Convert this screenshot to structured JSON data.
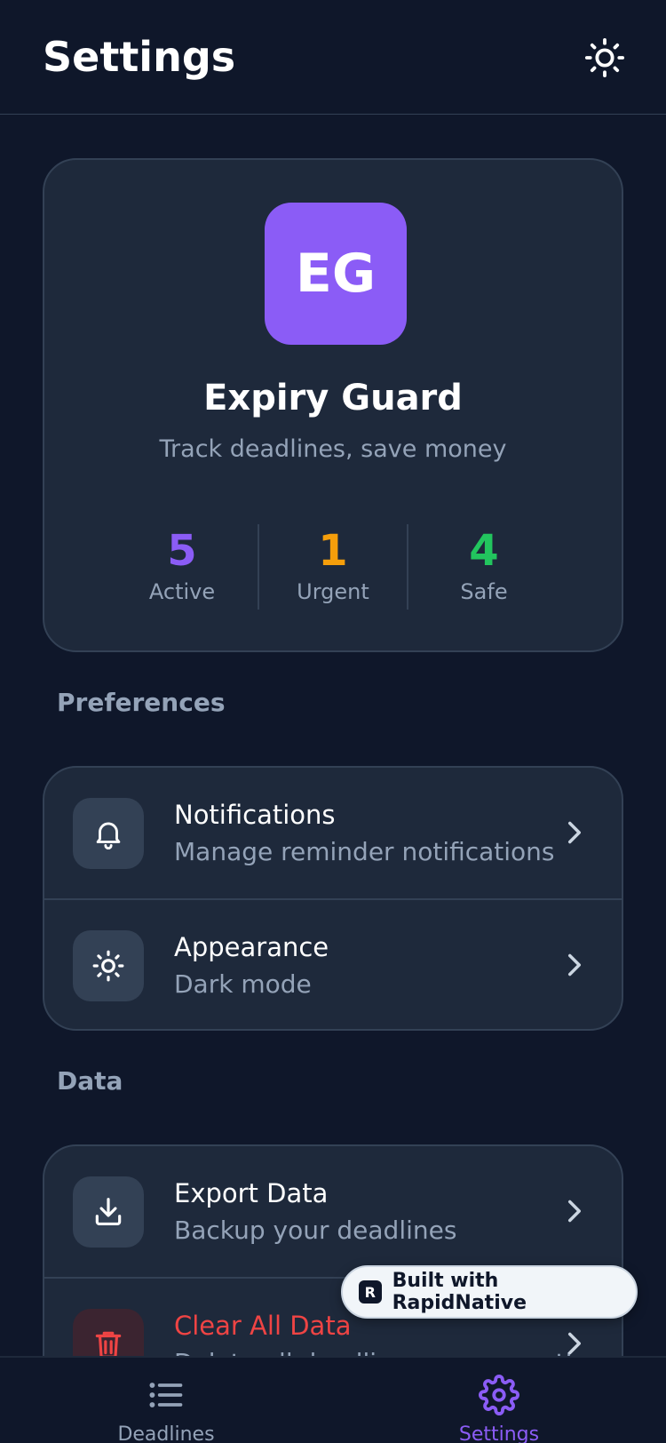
{
  "header": {
    "title": "Settings",
    "theme_icon": "sun-icon"
  },
  "profile": {
    "initials": "EG",
    "app_name": "Expiry Guard",
    "tagline": "Track deadlines, save money",
    "avatar_color": "#8b5cf6",
    "stats": [
      {
        "value": "5",
        "label": "Active",
        "color": "#8b5cf6"
      },
      {
        "value": "1",
        "label": "Urgent",
        "color": "#f59e0b"
      },
      {
        "value": "4",
        "label": "Safe",
        "color": "#22c55e"
      }
    ]
  },
  "preferences": {
    "heading": "Preferences",
    "items": [
      {
        "icon": "bell-icon",
        "title": "Notifications",
        "subtitle": "Manage reminder notifications"
      },
      {
        "icon": "sun-icon",
        "title": "Appearance",
        "subtitle": "Dark mode"
      }
    ]
  },
  "data_section": {
    "heading": "Data",
    "items": [
      {
        "icon": "download-icon",
        "title": "Export Data",
        "subtitle": "Backup your deadlines"
      },
      {
        "icon": "trash-icon",
        "title": "Clear All Data",
        "subtitle": "Delete all deadlines permanently",
        "danger_color": "#ef4444"
      }
    ]
  },
  "badge": {
    "text": "Built with RapidNative"
  },
  "nav": {
    "items": [
      {
        "icon": "list-icon",
        "label": "Deadlines",
        "active": false
      },
      {
        "icon": "gear-icon",
        "label": "Settings",
        "active": true
      }
    ],
    "active_color": "#8b5cf6"
  }
}
